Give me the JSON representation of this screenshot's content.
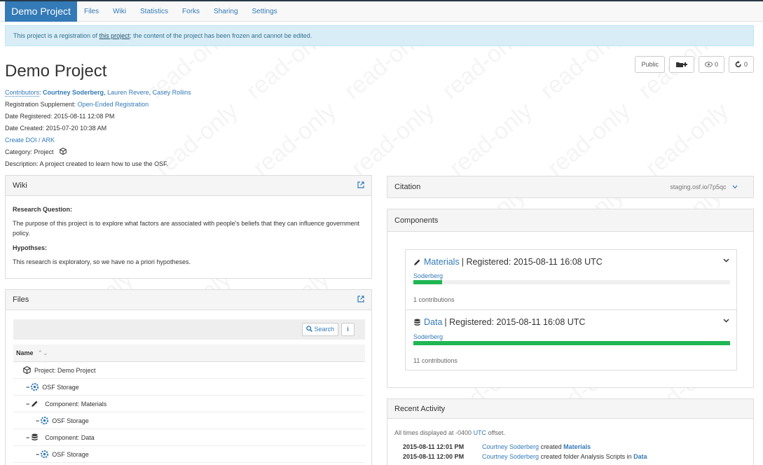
{
  "watermark": "read-only",
  "nav": {
    "brand": "Demo Project",
    "links": [
      "Files",
      "Wiki",
      "Statistics",
      "Forks",
      "Sharing",
      "Settings"
    ]
  },
  "alert": {
    "prefix": "This project is a registration of ",
    "link": "this project",
    "suffix": "; the content of the project has been frozen and cannot be edited."
  },
  "header_buttons": {
    "public_label": "Public",
    "watch_count": "0",
    "fork_count": "0"
  },
  "project": {
    "title": "Demo Project",
    "contributors_label": "Contributors",
    "contributors": [
      "Courtney Soderberg",
      "Lauren Revere",
      "Casey Rollins"
    ],
    "supplement_label": "Registration Supplement: ",
    "supplement_value": "Open-Ended Registration",
    "registered": "Date Registered: 2015-08-11 12:08 PM",
    "created": "Date Created: 2015-07-20 10:38 AM",
    "doi_link": "Create DOI / ARK",
    "category": "Category: Project",
    "description": "Description: A project created to learn how to use the OSF."
  },
  "wiki": {
    "title": "Wiki",
    "q_heading": "Research Question:",
    "q_text": "The purpose of this project is to explore what factors are associated with people's beliefs that they can influence government policy.",
    "h_heading": "Hypothses:",
    "h_text": "This research is exploratory, so we have no a priori hypotheses."
  },
  "files": {
    "title": "Files",
    "search_label": "Search",
    "info_label": "i",
    "name_header": "Name",
    "rows": [
      {
        "toggle": "",
        "icon": "cube-icon",
        "label": "Project: Demo Project"
      },
      {
        "toggle": "−",
        "icon": "osf-storage-icon",
        "label": "OSF Storage"
      },
      {
        "toggle": "−",
        "icon": "pencil-icon",
        "label": "Component: Materials"
      },
      {
        "toggle": "−",
        "icon": "osf-storage-icon",
        "label": "OSF Storage"
      },
      {
        "toggle": "−",
        "icon": "database-icon",
        "label": "Component: Data"
      },
      {
        "toggle": "−",
        "icon": "osf-storage-icon",
        "label": "OSF Storage"
      }
    ]
  },
  "citation": {
    "title": "Citation",
    "url": "staging.osf.io/7p5qc"
  },
  "components": {
    "title": "Components",
    "items": [
      {
        "icon": "pencil-icon",
        "name": "Materials",
        "registered": "| Registered: 2015-08-11 16:08 UTC",
        "user": "Soderberg",
        "contribution_fraction": 0.09,
        "count": "1 contributions"
      },
      {
        "icon": "database-icon",
        "name": "Data",
        "registered": "| Registered: 2015-08-11 16:08 UTC",
        "user": "Soderberg",
        "contribution_fraction": 1.0,
        "count": "11 contributions"
      }
    ]
  },
  "activity": {
    "title": "Recent Activity",
    "note_prefix": "All times displayed at -0400 ",
    "note_link": "UTC",
    "note_suffix": " offset.",
    "rows": [
      {
        "time": "2015-08-11 12:01 PM",
        "user": "Courtney Soderberg",
        "action": " created ",
        "target": "Materials"
      },
      {
        "time": "2015-08-11 12:00 PM",
        "user": "Courtney Soderberg",
        "action": " created folder Analysis Scripts in ",
        "target": "Data"
      }
    ]
  },
  "colors": {
    "brand": "#337ab7",
    "success": "#1fb653",
    "alert_bg": "#d9edf7"
  }
}
